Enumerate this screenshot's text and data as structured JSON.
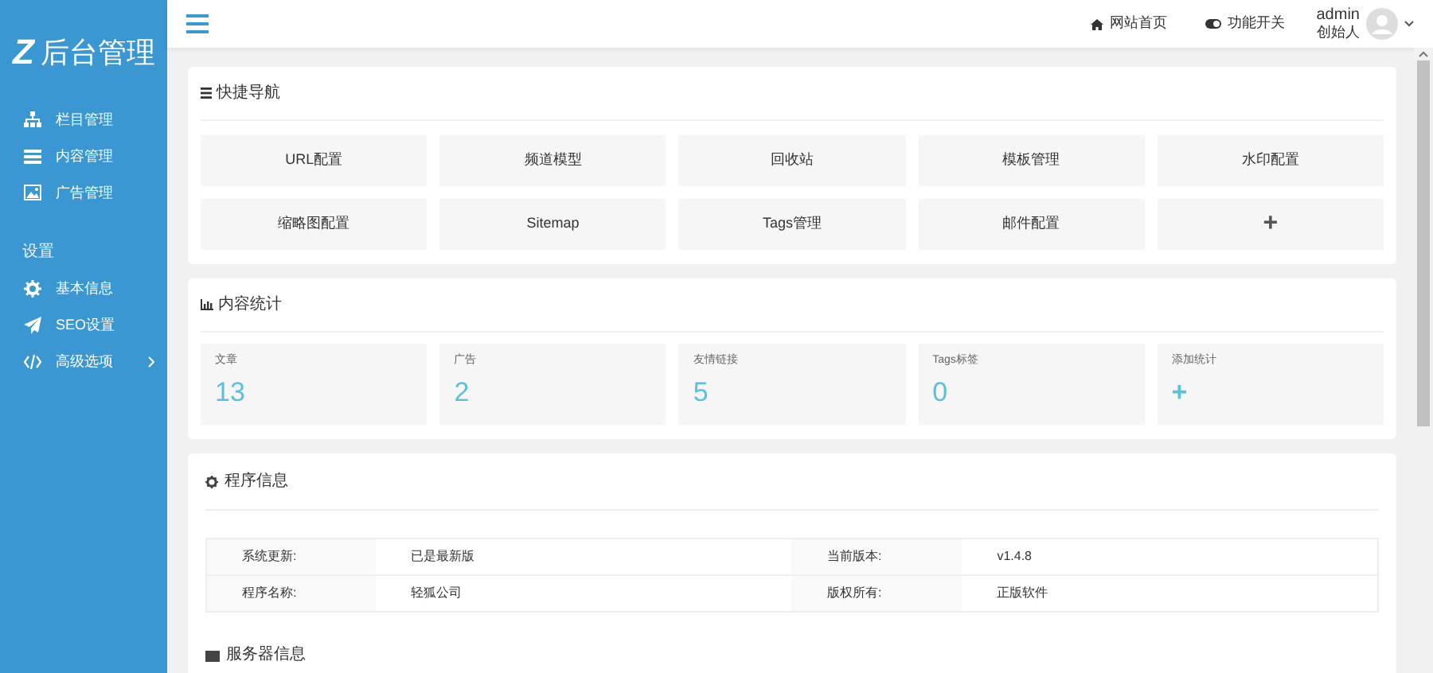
{
  "logo": {
    "mark": "Z",
    "text": "后台管理"
  },
  "sidebar": {
    "items": [
      {
        "label": "栏目管理"
      },
      {
        "label": "内容管理"
      },
      {
        "label": "广告管理"
      }
    ],
    "section": "设置",
    "settings": [
      {
        "label": "基本信息",
        "has_children": false
      },
      {
        "label": "SEO设置",
        "has_children": false
      },
      {
        "label": "高级选项",
        "has_children": true
      }
    ]
  },
  "header": {
    "links": [
      {
        "label": "网站首页"
      },
      {
        "label": "功能开关"
      }
    ],
    "user": {
      "name": "admin",
      "role": "创始人"
    }
  },
  "quick_nav": {
    "title": "快捷导航",
    "items": [
      {
        "kind": "text",
        "label": "URL配置"
      },
      {
        "kind": "text",
        "label": "频道模型"
      },
      {
        "kind": "text",
        "label": "回收站"
      },
      {
        "kind": "text",
        "label": "模板管理"
      },
      {
        "kind": "text",
        "label": "水印配置"
      },
      {
        "kind": "text",
        "label": "缩略图配置"
      },
      {
        "kind": "text",
        "label": "Sitemap"
      },
      {
        "kind": "text",
        "label": "Tags管理"
      },
      {
        "kind": "text",
        "label": "邮件配置"
      },
      {
        "kind": "add",
        "label": "+"
      }
    ]
  },
  "stats": {
    "title": "内容统计",
    "items": [
      {
        "kind": "number",
        "label": "文章",
        "value": "13"
      },
      {
        "kind": "number",
        "label": "广告",
        "value": "2"
      },
      {
        "kind": "number",
        "label": "友情链接",
        "value": "5"
      },
      {
        "kind": "number",
        "label": "Tags标签",
        "value": "0"
      },
      {
        "kind": "add",
        "label": "添加统计",
        "value": "+"
      }
    ]
  },
  "program_info": {
    "title": "程序信息",
    "rows": [
      [
        "系统更新:",
        "已是最新版",
        "当前版本:",
        "v1.4.8"
      ],
      [
        "程序名称:",
        "轻狐公司",
        "版权所有:",
        "正版软件"
      ]
    ]
  },
  "server_info": {
    "title": "服务器信息"
  }
}
